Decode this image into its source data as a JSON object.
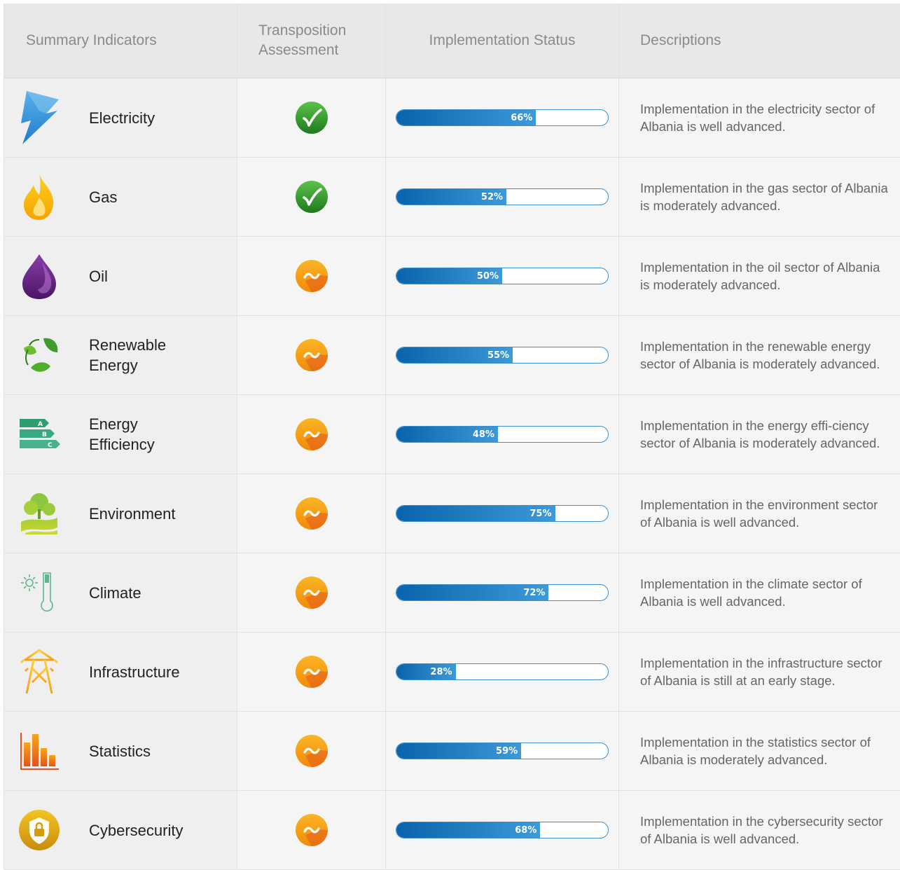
{
  "header": {
    "col1": "Summary Indicators",
    "col2_line1": "Transposition",
    "col2_line2": "Assessment",
    "col3": "Implementation Status",
    "col4": "Descriptions"
  },
  "colors": {
    "accent_blue": "#0a63ab",
    "good_green": "#2e9b2e",
    "partial_orange": "#f39c12"
  },
  "rows": [
    {
      "name": "Electricity",
      "icon": "lightning-icon",
      "assessment": "check",
      "percent": 66,
      "percent_label": "66%",
      "description": "Implementation in the electricity sector of Albania is well advanced."
    },
    {
      "name": "Gas",
      "icon": "flame-icon",
      "assessment": "check",
      "percent": 52,
      "percent_label": "52%",
      "description": "Implementation in the gas sector of Albania is moderately advanced."
    },
    {
      "name": "Oil",
      "icon": "oil-drop-icon",
      "assessment": "partial",
      "percent": 50,
      "percent_label": "50%",
      "description": "Implementation in the oil sector of Albania is moderately advanced."
    },
    {
      "name": "Renewable\nEnergy",
      "icon": "recycle-leaves-icon",
      "assessment": "partial",
      "percent": 55,
      "percent_label": "55%",
      "description": "Implementation in the renewable energy sector of Albania is moderately advanced."
    },
    {
      "name": "Energy\nEfficiency",
      "icon": "energy-rating-icon",
      "assessment": "partial",
      "percent": 48,
      "percent_label": "48%",
      "description": "Implementation in the energy effi-ciency sector of Albania is moderately advanced."
    },
    {
      "name": "Environment",
      "icon": "trees-icon",
      "assessment": "partial",
      "percent": 75,
      "percent_label": "75%",
      "description": "Implementation in the environment sector of Albania is well advanced."
    },
    {
      "name": "Climate",
      "icon": "thermometer-sun-icon",
      "assessment": "partial",
      "percent": 72,
      "percent_label": "72%",
      "description": "Implementation in the climate sector of Albania is well advanced."
    },
    {
      "name": "Infrastructure",
      "icon": "power-pylon-icon",
      "assessment": "partial",
      "percent": 28,
      "percent_label": "28%",
      "description": "Implementation in the infrastructure sector of Albania is still at an early stage."
    },
    {
      "name": "Statistics",
      "icon": "bar-chart-icon",
      "assessment": "partial",
      "percent": 59,
      "percent_label": "59%",
      "description": "Implementation in the statistics sector of Albania is moderately advanced."
    },
    {
      "name": "Cybersecurity",
      "icon": "shield-lock-icon",
      "assessment": "partial",
      "percent": 68,
      "percent_label": "68%",
      "description": "Implementation in the cybersecurity sector of Albania is well advanced."
    }
  ]
}
